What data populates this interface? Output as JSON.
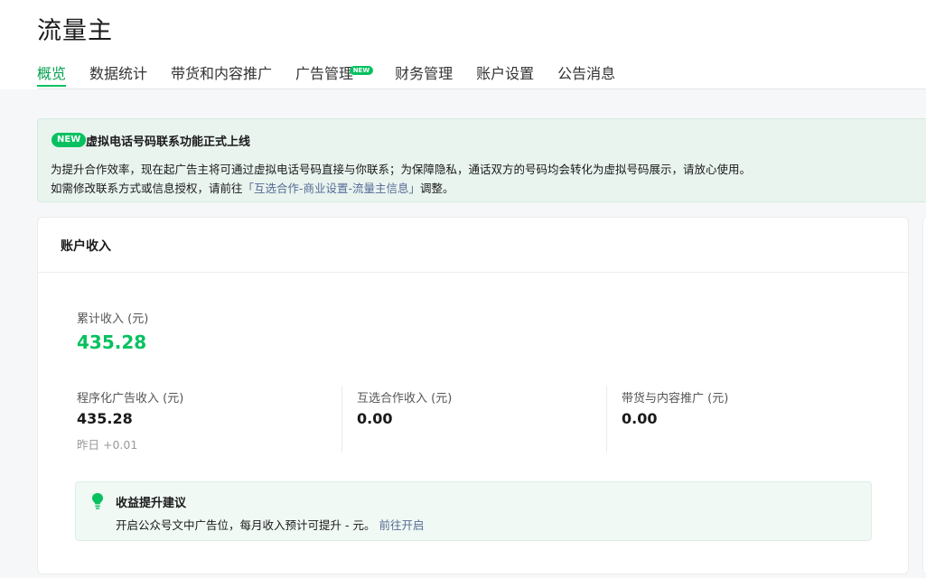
{
  "header": {
    "title": "流量主",
    "tabs": [
      {
        "label": "概览",
        "active": true
      },
      {
        "label": "数据统计"
      },
      {
        "label": "带货和内容推广"
      },
      {
        "label": "广告管理",
        "badge": "NEW"
      },
      {
        "label": "财务管理"
      },
      {
        "label": "账户设置"
      },
      {
        "label": "公告消息"
      }
    ]
  },
  "notice": {
    "badge": "NEW",
    "title": "虚拟电话号码联系功能正式上线",
    "line1": "为提升合作效率，现在起广告主将可通过虚拟电话号码直接与你联系；为保障隐私，通话双方的号码均会转化为虚拟号码展示，请放心使用。",
    "line2_prefix": "如需修改联系方式或信息授权，请前往",
    "line2_link": "「互选合作-商业设置-流量主信息」",
    "line2_suffix": "调整。"
  },
  "account_income": {
    "title": "账户收入",
    "total_label": "累计收入 (元)",
    "total_value": "435.28",
    "metrics": [
      {
        "label": "程序化广告收入 (元)",
        "value": "435.28",
        "delta": "昨日 +0.01"
      },
      {
        "label": "互选合作收入 (元)",
        "value": "0.00"
      },
      {
        "label": "带货与内容推广 (元)",
        "value": "0.00"
      }
    ],
    "tip": {
      "title": "收益提升建议",
      "text": "开启公众号文中广告位，每月收入预计可提升 - 元。",
      "link": "前往开启"
    }
  },
  "colors": {
    "accent": "#07c160",
    "link": "#576b95",
    "notice_bg": "#e9f4ef",
    "tip_bg": "#f0f9f4"
  }
}
